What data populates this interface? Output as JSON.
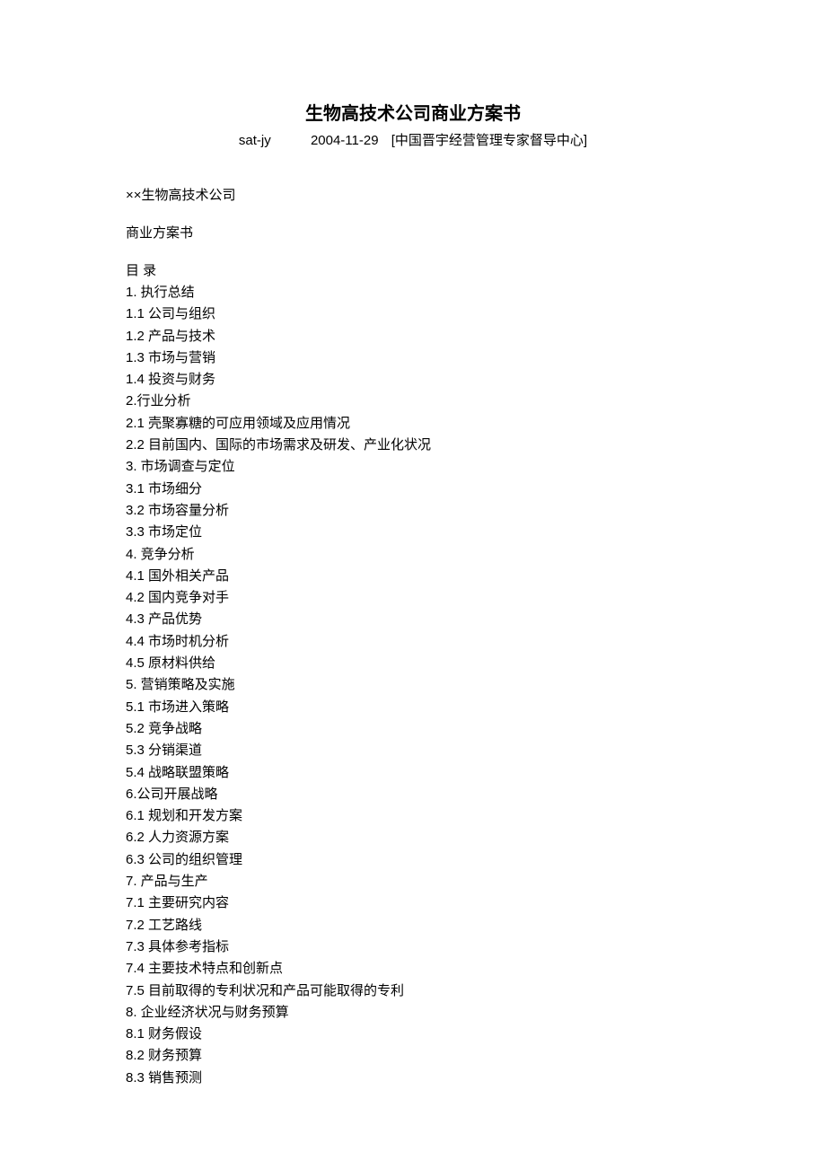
{
  "title": "生物高技术公司商业方案书",
  "byline": {
    "author": "sat-jy",
    "date": "2004-11-29",
    "source": "[中国晋宇经营管理专家督导中心]"
  },
  "company_line": "××生物高技术公司",
  "doc_type": "商业方案书",
  "toc_heading": "目 录",
  "toc": [
    "1.   执行总结",
    "1.1 公司与组织",
    "1.2 产品与技术",
    "1.3 市场与营销",
    "1.4 投资与财务",
    "2.行业分析",
    "2.1 壳聚寡糖的可应用领域及应用情况",
    "2.2 目前国内、国际的市场需求及研发、产业化状况",
    "3.  市场调查与定位",
    "3.1 市场细分",
    "3.2 市场容量分析",
    "3.3 市场定位",
    "4.  竞争分析",
    "4.1 国外相关产品",
    "4.2  国内竞争对手",
    "4.3 产品优势",
    "4.4 市场时机分析",
    "4.5 原材料供给",
    "5.  营销策略及实施",
    "5.1  市场进入策略",
    "5.2  竞争战略",
    "5.3 分销渠道",
    "5.4  战略联盟策略",
    "6.公司开展战略",
    "6.1 规划和开发方案",
    "6.2 人力资源方案",
    "6.3 公司的组织管理",
    "7.  产品与生产",
    "7.1 主要研究内容",
    "7.2 工艺路线",
    "7.3 具体参考指标",
    "7.4 主要技术特点和创新点",
    "7.5 目前取得的专利状况和产品可能取得的专利",
    "8.  企业经济状况与财务预算",
    "8.1 财务假设",
    "8.2 财务预算",
    "8.3 销售预测"
  ]
}
